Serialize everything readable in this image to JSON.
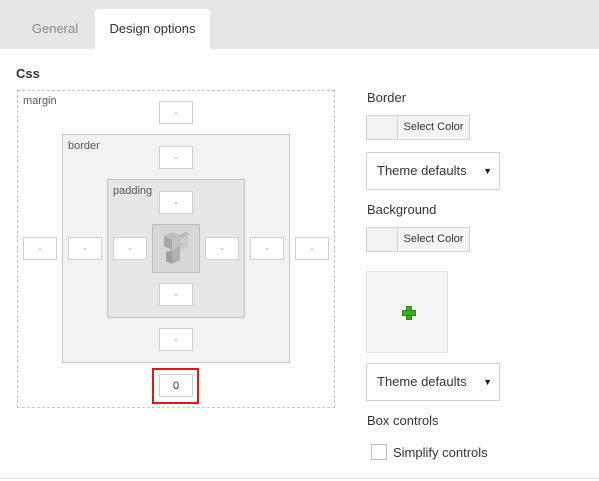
{
  "tabs": {
    "general": "General",
    "design_options": "Design options"
  },
  "css": {
    "heading": "Css",
    "labels": {
      "margin": "margin",
      "border": "border",
      "padding": "padding"
    },
    "margin": {
      "top": "-",
      "right": "-",
      "bottom": "0",
      "left": "-"
    },
    "border": {
      "top": "-",
      "right": "-",
      "bottom": "-",
      "left": "-"
    },
    "padding": {
      "top": "-",
      "right": "-",
      "bottom": "-",
      "left": "-"
    },
    "center_icon": "vc-logo-icon"
  },
  "border_section": {
    "heading": "Border",
    "color_button": "Select Color",
    "style_select": "Theme defaults"
  },
  "background_section": {
    "heading": "Background",
    "color_button": "Select Color",
    "add_image_icon": "plus-icon",
    "style_select": "Theme defaults"
  },
  "box_controls": {
    "heading": "Box controls",
    "simplify_label": "Simplify controls",
    "simplify_checked": false
  },
  "colors": {
    "highlight": "#cc1f1f",
    "plus_icon": "#3aae21"
  }
}
